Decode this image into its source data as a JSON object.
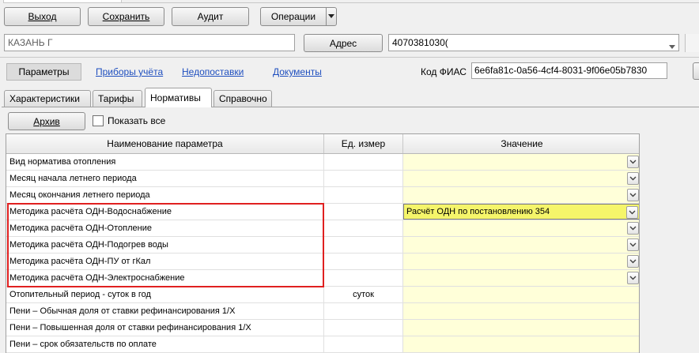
{
  "toolbar": {
    "exit_label": "Выход",
    "save_label": "Сохранить",
    "audit_label": "Аудит",
    "operations_label": "Операции"
  },
  "address_bar": {
    "city_value": "КАЗАНЬ Г",
    "address_button": "Адрес",
    "account_value": "4070381030("
  },
  "subnav": {
    "params_label": "Параметры",
    "links": [
      "Приборы учёта",
      "Недопоставки",
      "Документы"
    ],
    "fias_label": "Код ФИАС",
    "fias_value": "6e6fa81c-0a56-4cf4-8031-9f06e05b7830"
  },
  "tabs": [
    {
      "label": "Характеристики",
      "active": false
    },
    {
      "label": "Тарифы",
      "active": false
    },
    {
      "label": "Нормативы",
      "active": true
    },
    {
      "label": "Справочно",
      "active": false
    }
  ],
  "panel": {
    "archive_label": "Архив",
    "show_all_label": "Показать все"
  },
  "grid": {
    "columns": [
      "Наименование параметра",
      "Ед. измер",
      "Значение"
    ],
    "rows": [
      {
        "name": "Вид норматива отопления",
        "unit": "",
        "value": "",
        "dropdown": true
      },
      {
        "name": "Месяц начала летнего периода",
        "unit": "",
        "value": "",
        "dropdown": true
      },
      {
        "name": "Месяц окончания летнего периода",
        "unit": "",
        "value": "",
        "dropdown": true
      },
      {
        "name": "Методика расчёта ОДН-Водоснабжение",
        "unit": "",
        "value": "Расчёт ОДН по постановлению 354",
        "dropdown": true,
        "selected": true
      },
      {
        "name": "Методика расчёта ОДН-Отопление",
        "unit": "",
        "value": "",
        "dropdown": true
      },
      {
        "name": "Методика расчёта ОДН-Подогрев воды",
        "unit": "",
        "value": "",
        "dropdown": true
      },
      {
        "name": "Методика расчёта ОДН-ПУ от гКал",
        "unit": "",
        "value": "",
        "dropdown": true
      },
      {
        "name": "Методика расчёта ОДН-Электроснабжение",
        "unit": "",
        "value": "",
        "dropdown": true
      },
      {
        "name": "Отопительный период - суток в год",
        "unit": "суток",
        "value": "",
        "dropdown": false
      },
      {
        "name": "Пени – Обычная доля от ставки рефинансирования 1/X",
        "unit": "",
        "value": "",
        "dropdown": false
      },
      {
        "name": "Пени – Повышенная доля от ставки рефинансирования 1/X",
        "unit": "",
        "value": "",
        "dropdown": false
      },
      {
        "name": "Пени – срок обязательств по оплате",
        "unit": "",
        "value": "",
        "dropdown": false
      }
    ]
  },
  "colors": {
    "value_cell": "#ffffd9",
    "selected_cell": "#f5f56a",
    "highlight": "#e02020",
    "link": "#1f4fbf"
  }
}
